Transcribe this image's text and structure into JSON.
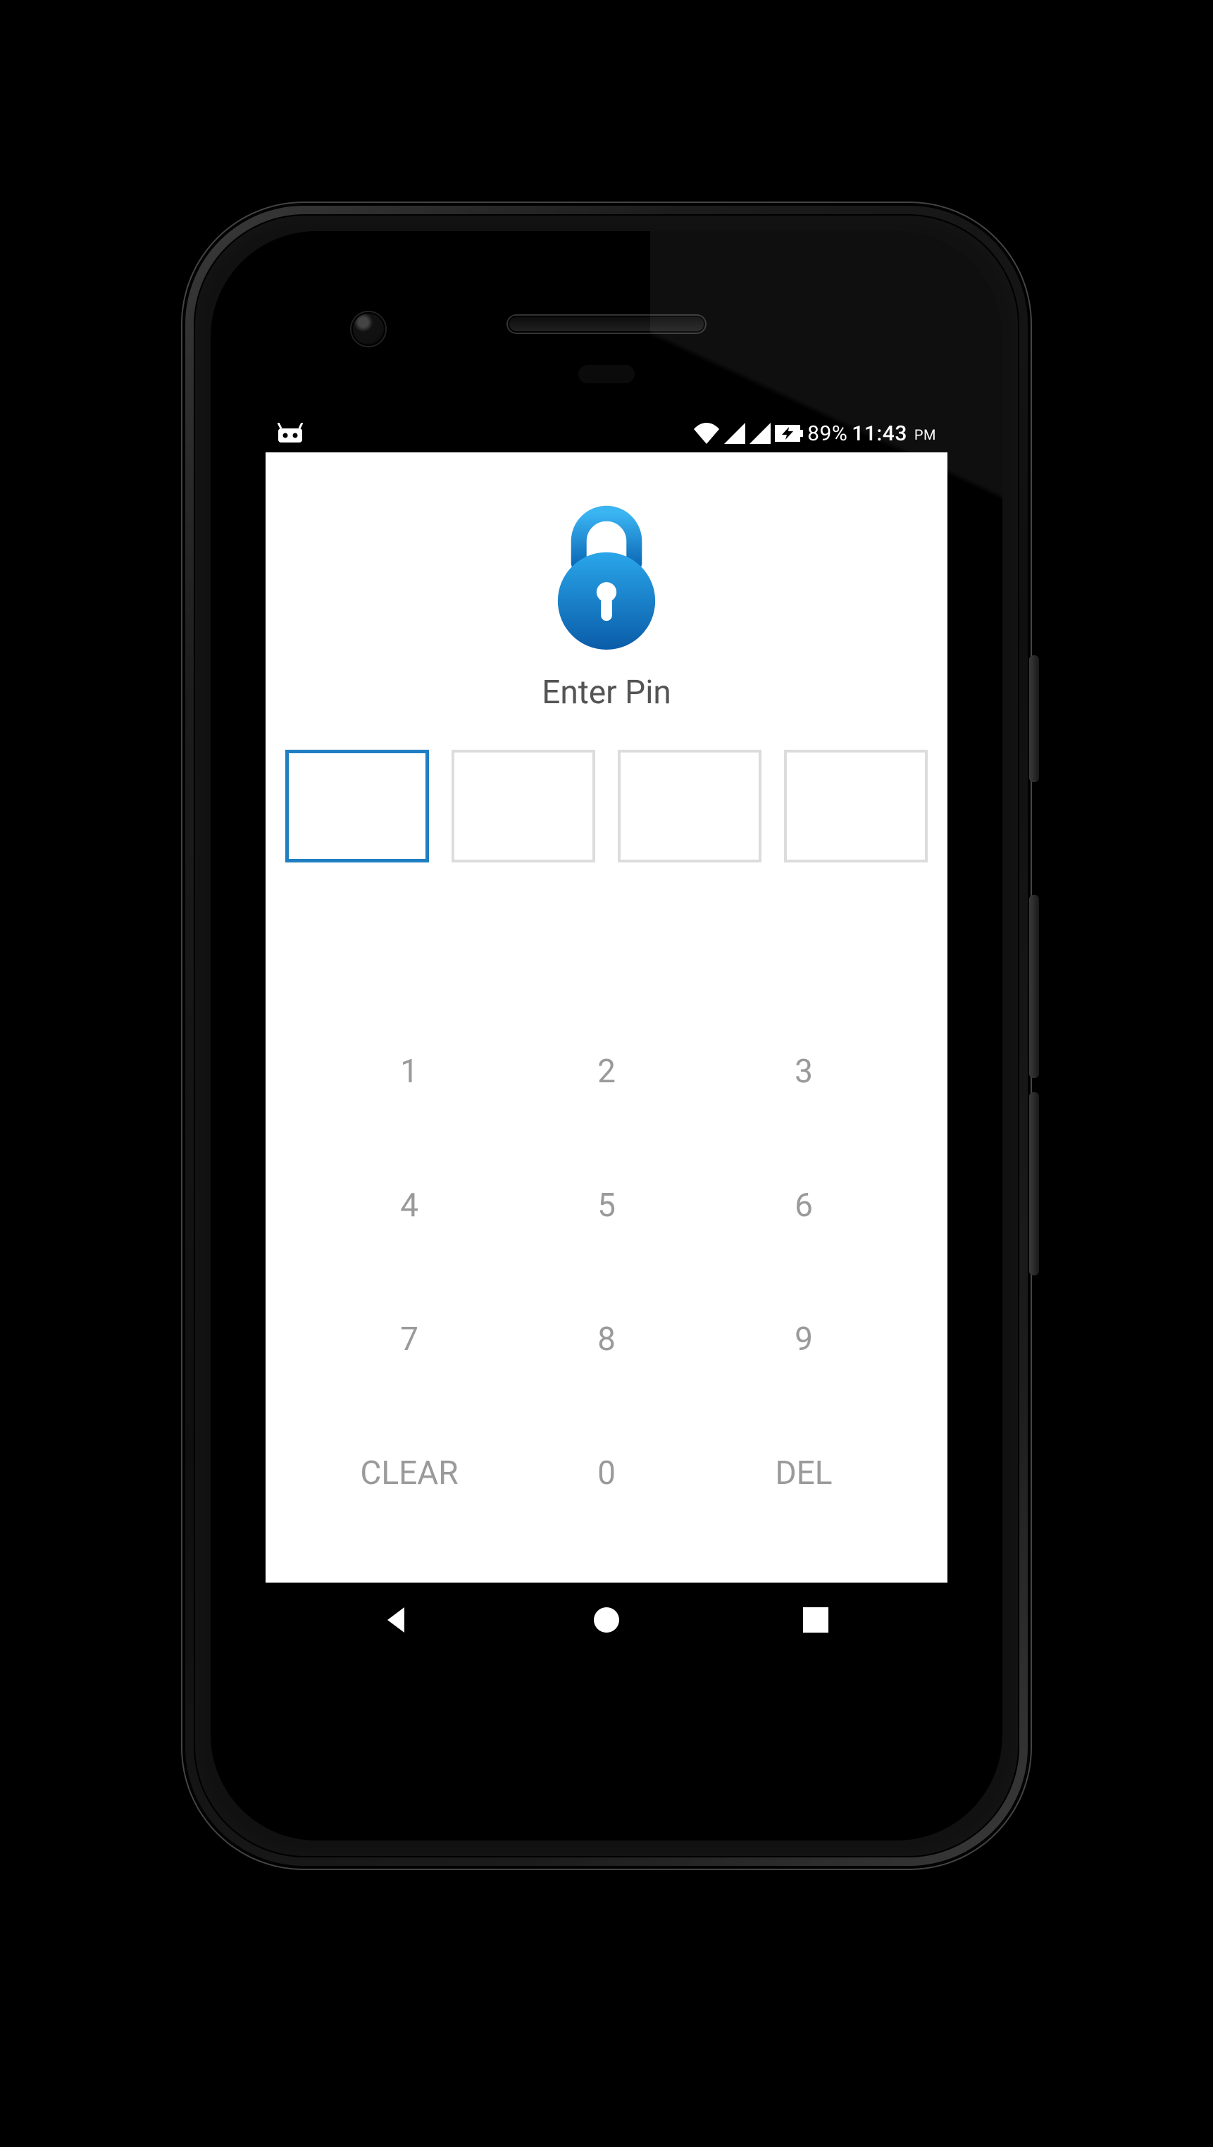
{
  "statusbar": {
    "battery_percent": "89%",
    "time": "11:43",
    "ampm": "PM"
  },
  "lockscreen": {
    "prompt": "Enter Pin",
    "digits": 4,
    "active_index": 0
  },
  "keypad": {
    "keys": [
      "1",
      "2",
      "3",
      "4",
      "5",
      "6",
      "7",
      "8",
      "9",
      "CLEAR",
      "0",
      "DEL"
    ]
  },
  "colors": {
    "accent": "#1f7fc2",
    "keypad_text": "#9a9a9a",
    "prompt_text": "#545454",
    "box_border": "#dcdcdc"
  }
}
